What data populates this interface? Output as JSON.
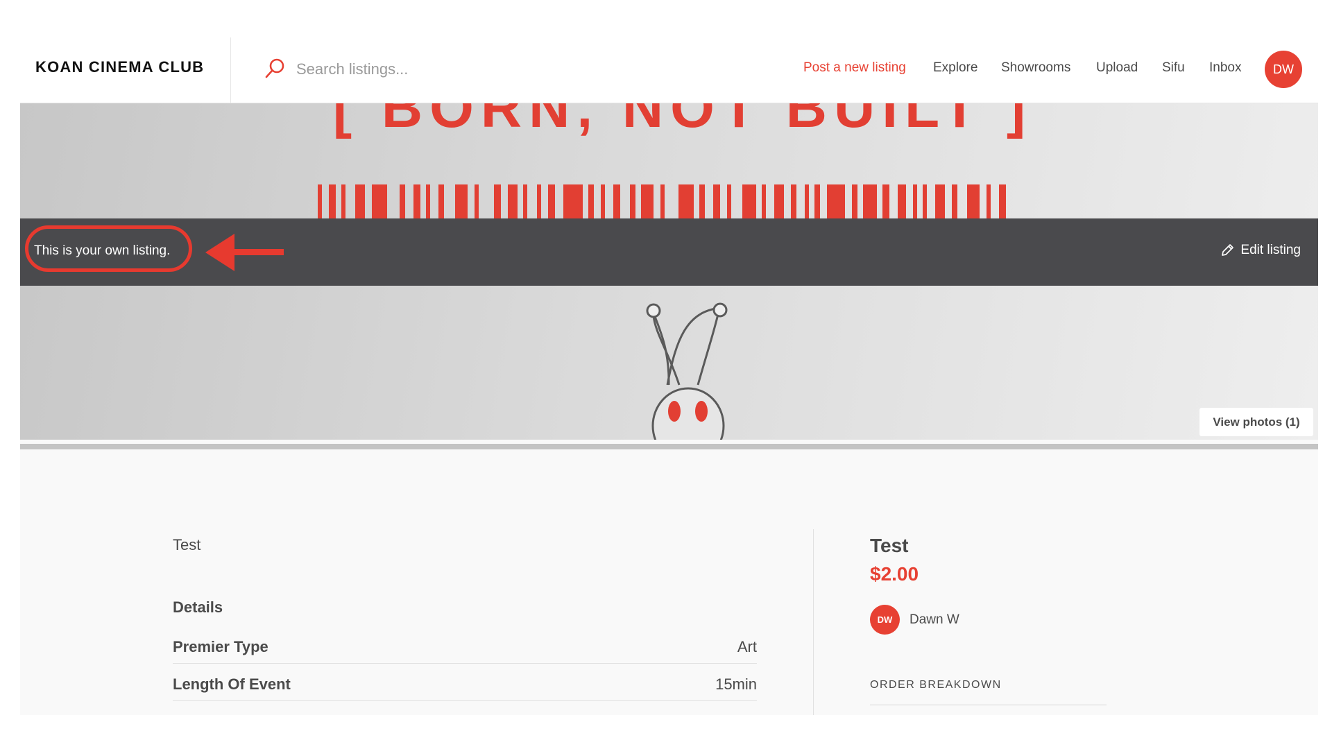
{
  "header": {
    "logo": "KOAN CINEMA CLUB",
    "search_placeholder": "Search listings...",
    "nav": [
      {
        "label": "Post a new listing",
        "accent": true
      },
      {
        "label": "Explore"
      },
      {
        "label": "Showrooms"
      },
      {
        "label": "Upload"
      },
      {
        "label": "Sifu"
      },
      {
        "label": "Inbox"
      }
    ],
    "avatar_initials": "DW"
  },
  "hero": {
    "art_text": "[ BORN, NOT BUILT ]",
    "own_listing_notice": "This is your own listing.",
    "edit_label": "Edit listing",
    "view_photos_label": "View photos (1)"
  },
  "listing": {
    "description": "Test",
    "details_heading": "Details",
    "details": [
      {
        "key": "Premier Type",
        "value": "Art"
      },
      {
        "key": "Length Of Event",
        "value": "15min"
      }
    ]
  },
  "sidebar": {
    "title": "Test",
    "price": "$2.00",
    "author_initials": "DW",
    "author_name": "Dawn W",
    "order_heading": "ORDER BREAKDOWN"
  },
  "colors": {
    "accent": "#e74133",
    "banner": "#4a4a4d",
    "text": "#4a4a4a"
  },
  "icons": [
    "search-icon",
    "pencil-icon",
    "arrow-left-icon",
    "robot-mascot-icon"
  ]
}
